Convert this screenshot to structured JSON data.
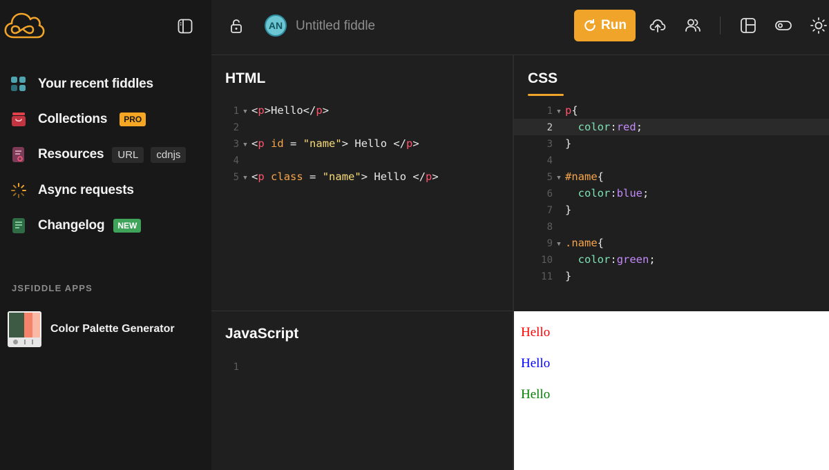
{
  "sidebar": {
    "nav": [
      {
        "label": "Your recent fiddles",
        "icon": "grid-icon"
      },
      {
        "label": "Collections",
        "icon": "box-icon",
        "badge": "PRO"
      },
      {
        "label": "Resources",
        "icon": "resources-icon",
        "chips": [
          "URL",
          "cdnjs"
        ]
      },
      {
        "label": "Async requests",
        "icon": "spinner-icon"
      },
      {
        "label": "Changelog",
        "icon": "changelog-icon",
        "badge": "NEW"
      }
    ],
    "apps_heading": "JSFIDDLE APPS",
    "apps": [
      {
        "label": "Color Palette Generator"
      }
    ]
  },
  "topbar": {
    "avatar_initials": "AN",
    "fiddle_title": "Untitled fiddle",
    "run_label": "Run"
  },
  "panels": {
    "html": {
      "title": "HTML",
      "line_numbers": [
        "1",
        "2",
        "3",
        "4",
        "5"
      ],
      "lines": [
        [
          {
            "t": "<",
            "c": "punc"
          },
          {
            "t": "p",
            "c": "tag"
          },
          {
            "t": ">Hello</",
            "c": "punc"
          },
          {
            "t": "p",
            "c": "tag"
          },
          {
            "t": ">",
            "c": "punc"
          }
        ],
        [],
        [
          {
            "t": "<",
            "c": "punc"
          },
          {
            "t": "p",
            "c": "tag"
          },
          {
            "t": " ",
            "c": "punc"
          },
          {
            "t": "id",
            "c": "attr"
          },
          {
            "t": " = ",
            "c": "punc"
          },
          {
            "t": "\"name\"",
            "c": "str"
          },
          {
            "t": "> Hello </",
            "c": "punc"
          },
          {
            "t": "p",
            "c": "tag"
          },
          {
            "t": ">",
            "c": "punc"
          }
        ],
        [],
        [
          {
            "t": "<",
            "c": "punc"
          },
          {
            "t": "p",
            "c": "tag"
          },
          {
            "t": " ",
            "c": "punc"
          },
          {
            "t": "class",
            "c": "attr"
          },
          {
            "t": " = ",
            "c": "punc"
          },
          {
            "t": "\"name\"",
            "c": "str"
          },
          {
            "t": "> Hello </",
            "c": "punc"
          },
          {
            "t": "p",
            "c": "tag"
          },
          {
            "t": ">",
            "c": "punc"
          }
        ]
      ]
    },
    "css": {
      "title": "CSS",
      "line_numbers": [
        "1",
        "2",
        "3",
        "4",
        "5",
        "6",
        "7",
        "8",
        "9",
        "10",
        "11"
      ],
      "lines": [
        [
          {
            "t": "p",
            "c": "tag"
          },
          {
            "t": "{",
            "c": "punc"
          }
        ],
        [
          {
            "t": "  ",
            "c": "punc"
          },
          {
            "t": "color",
            "c": "prop"
          },
          {
            "t": ":",
            "c": "punc"
          },
          {
            "t": "red",
            "c": "val"
          },
          {
            "t": ";",
            "c": "punc"
          }
        ],
        [
          {
            "t": "}",
            "c": "punc"
          }
        ],
        [],
        [
          {
            "t": "#name",
            "c": "sel"
          },
          {
            "t": "{",
            "c": "punc"
          }
        ],
        [
          {
            "t": "  ",
            "c": "punc"
          },
          {
            "t": "color",
            "c": "prop"
          },
          {
            "t": ":",
            "c": "punc"
          },
          {
            "t": "blue",
            "c": "val"
          },
          {
            "t": ";",
            "c": "punc"
          }
        ],
        [
          {
            "t": "}",
            "c": "punc"
          }
        ],
        [],
        [
          {
            "t": ".name",
            "c": "sel"
          },
          {
            "t": "{",
            "c": "punc"
          }
        ],
        [
          {
            "t": "  ",
            "c": "punc"
          },
          {
            "t": "color",
            "c": "prop"
          },
          {
            "t": ":",
            "c": "punc"
          },
          {
            "t": "green",
            "c": "val"
          },
          {
            "t": ";",
            "c": "punc"
          }
        ],
        [
          {
            "t": "}",
            "c": "punc"
          }
        ]
      ]
    },
    "js": {
      "title": "JavaScript",
      "line_numbers": [
        "1"
      ]
    }
  },
  "result": {
    "items": [
      {
        "text": "Hello",
        "color": "#ff0000"
      },
      {
        "text": "Hello",
        "color": "#0000ff"
      },
      {
        "text": "Hello",
        "color": "#008000"
      }
    ]
  },
  "colors": {
    "accent": "#f0a42a",
    "badge_pro": "#f5a623",
    "badge_new": "#3fa35a"
  }
}
